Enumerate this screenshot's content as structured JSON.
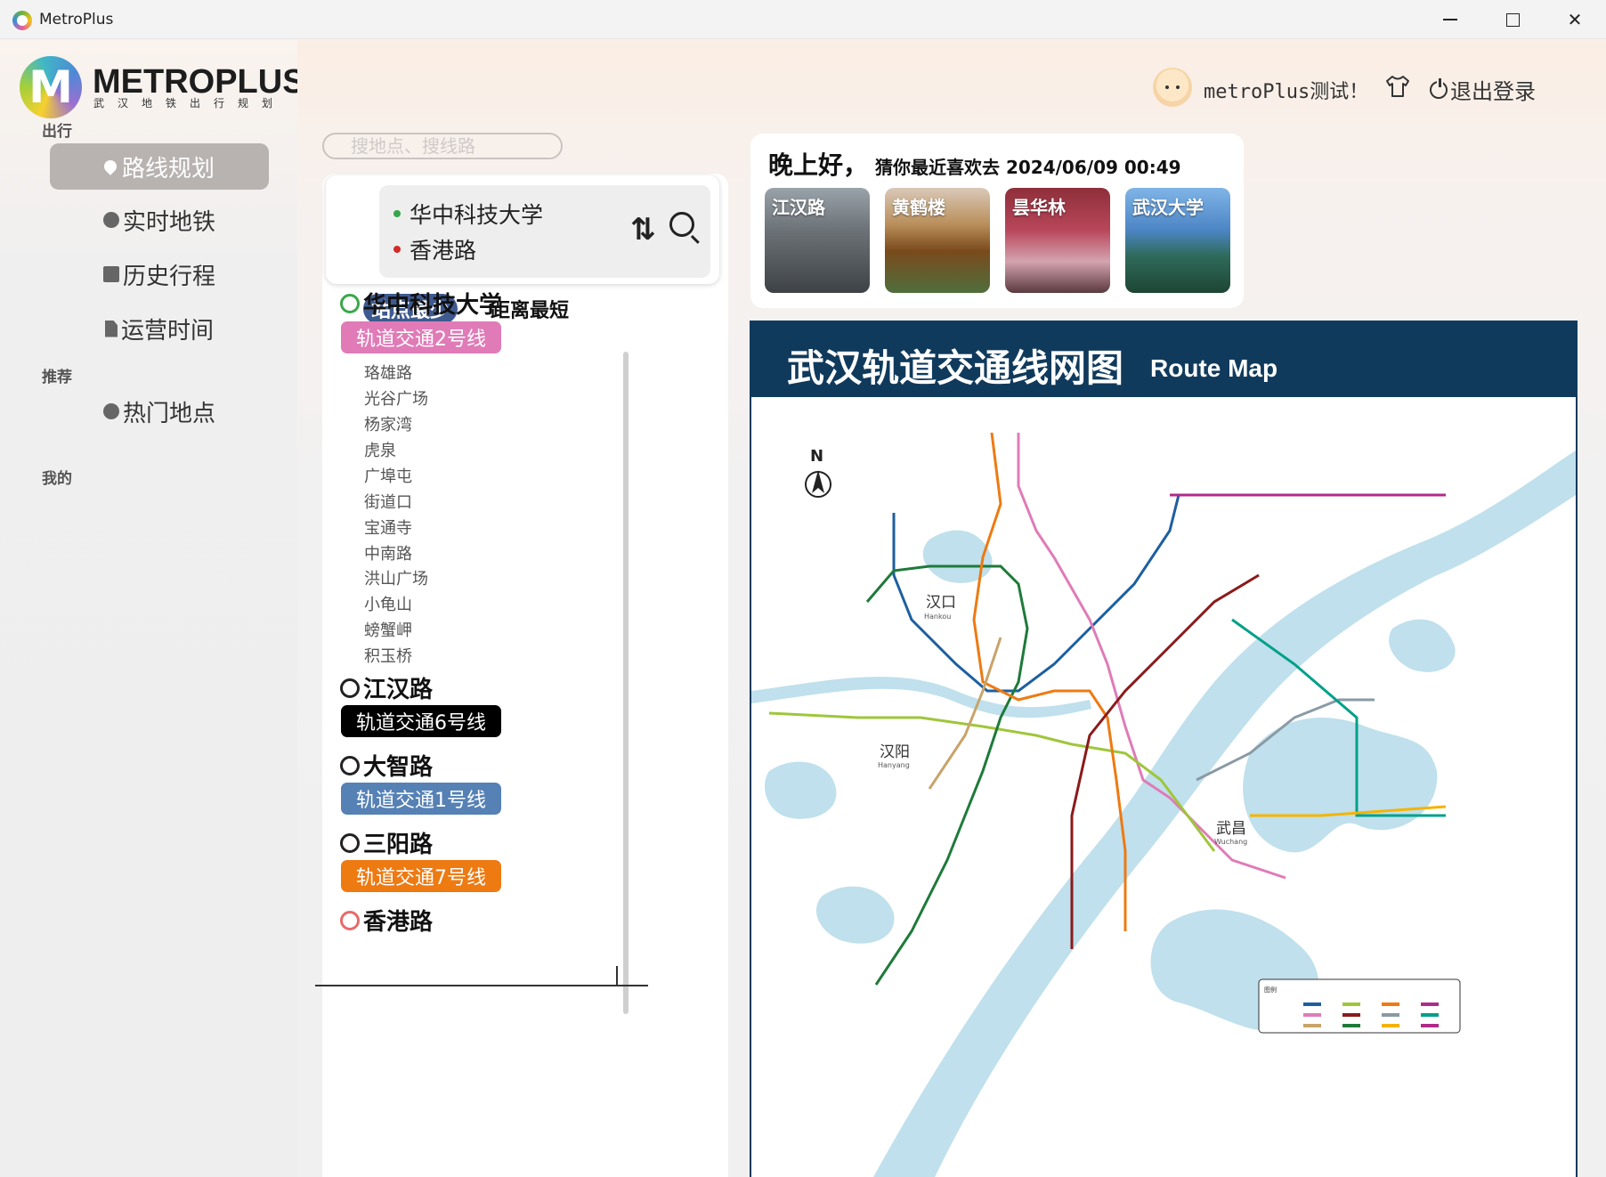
{
  "window": {
    "title": "MetroPlus",
    "min": "—",
    "max": "☐",
    "close": "✕"
  },
  "brand": {
    "name": "METROPLUS",
    "subtitle": "武汉地铁出行规划"
  },
  "sidebar": {
    "section_go": "出行",
    "section_recommend": "推荐",
    "section_mine": "我的",
    "items": [
      {
        "label": "路线规划",
        "icon": "pin-icon"
      },
      {
        "label": "实时地铁",
        "icon": "clock-icon"
      },
      {
        "label": "历史行程",
        "icon": "calendar-icon"
      },
      {
        "label": "运营时间",
        "icon": "document-icon"
      },
      {
        "label": "热门地点",
        "icon": "fire-icon"
      }
    ]
  },
  "header": {
    "user_name": "metroPlus测试！",
    "logout_label": "退出登录"
  },
  "search": {
    "placeholder": "搜地点、搜线路"
  },
  "route": {
    "origin": "华中科技大学",
    "destination": "香港路",
    "swap_label": "⇅",
    "tab_fewest": "站点最少",
    "tab_shortest": "距离最短",
    "segments": [
      {
        "station": "华中科技大学",
        "line": "轨道交通2号线",
        "line_color": "#e07bb7",
        "via": [
          "珞雄路",
          "光谷广场",
          "杨家湾",
          "虎泉",
          "广埠屯",
          "街道口",
          "宝通寺",
          "中南路",
          "洪山广场",
          "小龟山",
          "螃蟹岬",
          "积玉桥"
        ]
      },
      {
        "station": "江汉路",
        "line": "轨道交通6号线",
        "line_color": "#000000",
        "via": []
      },
      {
        "station": "大智路",
        "line": "轨道交通1号线",
        "line_color": "#5581b5",
        "via": []
      },
      {
        "station": "三阳路",
        "line": "轨道交通7号线",
        "line_color": "#ee7a12",
        "via": []
      },
      {
        "station": "香港路"
      }
    ]
  },
  "greeting": {
    "hello": "晚上好，",
    "recent": "猜你最近喜欢去 2024/06/09 00:49",
    "places": [
      "江汉路",
      "黄鹤楼",
      "昙华林",
      "武汉大学"
    ]
  },
  "map": {
    "title": "武汉轨道交通线网图",
    "title_en": "Route Map",
    "north": "N",
    "labels": {
      "hankou": "汉口",
      "hankou_en": "Hankou",
      "hanyang": "汉阳",
      "hanyang_en": "Hanyang",
      "wuchang": "武昌",
      "wuchang_en": "Wuchang"
    },
    "river_color": "#bfe0ec",
    "line_colors": [
      "#1d5fa0",
      "#e07bb7",
      "#9fc63a",
      "#1e7a3a",
      "#ee7a12",
      "#8b1a1a",
      "#b02a8a",
      "#8a9aa5",
      "#00a08a",
      "#c8a46a",
      "#f5b300"
    ],
    "legend_title": "图例"
  }
}
